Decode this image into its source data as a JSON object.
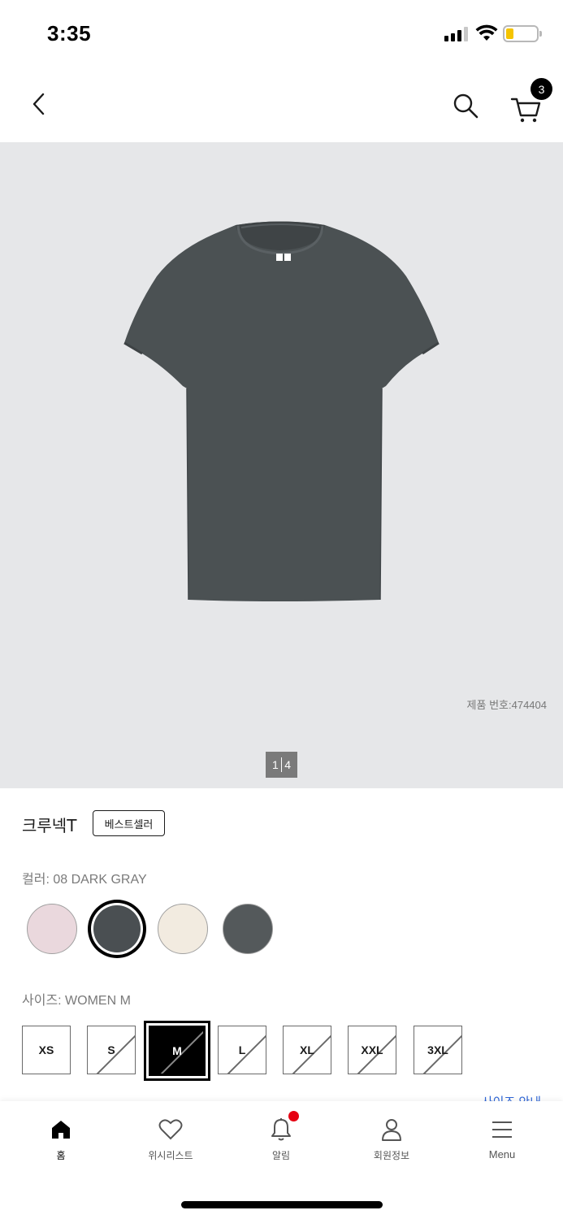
{
  "status_bar": {
    "time": "3:35"
  },
  "header": {
    "cart_count": "3"
  },
  "product_image": {
    "product_number": "제품 번호:474404",
    "pager_current": "1",
    "pager_total": "4"
  },
  "product": {
    "name": "크루넥T",
    "badge": "베스트셀러",
    "color_label": "컬러: 08 DARK GRAY",
    "colors": [
      {
        "hex": "#ead8dd",
        "selected": false
      },
      {
        "hex": "#4a4f52",
        "selected": true
      },
      {
        "hex": "#f2ebe0",
        "selected": false
      },
      {
        "hex": "#54595b",
        "selected": false
      }
    ],
    "size_label": "사이즈: WOMEN M",
    "sizes": [
      {
        "label": "XS",
        "available": true,
        "selected": false
      },
      {
        "label": "S",
        "available": false,
        "selected": false
      },
      {
        "label": "M",
        "available": false,
        "selected": true
      },
      {
        "label": "L",
        "available": false,
        "selected": false
      },
      {
        "label": "XL",
        "available": false,
        "selected": false
      },
      {
        "label": "XXL",
        "available": false,
        "selected": false
      },
      {
        "label": "3XL",
        "available": false,
        "selected": false
      }
    ],
    "size_guide_link": "사이즈 안내"
  },
  "tab_bar": {
    "items": [
      {
        "label": "홈",
        "icon": "home-icon"
      },
      {
        "label": "위시리스트",
        "icon": "heart-icon"
      },
      {
        "label": "알림",
        "icon": "bell-icon"
      },
      {
        "label": "회원정보",
        "icon": "person-icon"
      },
      {
        "label": "Menu",
        "icon": "menu-icon"
      }
    ]
  },
  "colors": {
    "image_bg": "#e6e7e9",
    "shirt": "#4b5153",
    "alert": "#e60012",
    "link": "#2f66d6",
    "battery": "#f5c400"
  }
}
